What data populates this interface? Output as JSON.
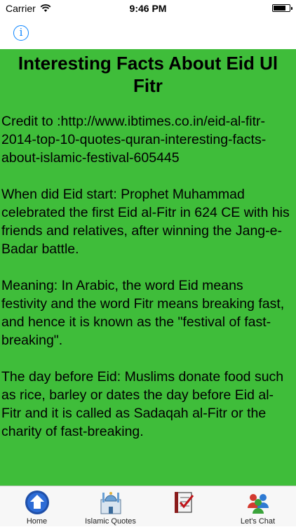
{
  "status_bar": {
    "carrier": "Carrier",
    "time": "9:46 PM",
    "wifi_icon": "wifi-icon",
    "battery_icon": "battery-icon"
  },
  "nav": {
    "info_glyph": "i",
    "info_icon": "info-icon",
    "accent_color": "#0a84ff"
  },
  "article": {
    "title": "Interesting Facts About Eid Ul Fitr",
    "paragraphs": [
      "Credit to :http://www.ibtimes.co.in/eid-al-fitr-2014-top-10-quotes-quran-interesting-facts-about-islamic-festival-605445",
      "When did Eid start: Prophet Muhammad celebrated the first Eid al-Fitr in 624 CE with his friends and relatives, after winning the Jang-e-Badar battle.",
      "Meaning: In Arabic, the word Eid means festivity and the word Fitr means breaking fast, and hence it is known as the \"festival of fast-breaking\".",
      "The day before Eid: Muslims donate food such as rice, barley or dates the day before Eid al-Fitr and it is called as Sadaqah al-Fitr or the charity of fast-breaking."
    ],
    "background_color": "#3fbd3a"
  },
  "tabs": [
    {
      "label": "Home",
      "icon": "home-icon"
    },
    {
      "label": "Islamic Quotes",
      "icon": "mosque-icon"
    },
    {
      "label": "",
      "icon": "checklist-icon"
    },
    {
      "label": "Let's Chat",
      "icon": "chat-people-icon"
    }
  ]
}
